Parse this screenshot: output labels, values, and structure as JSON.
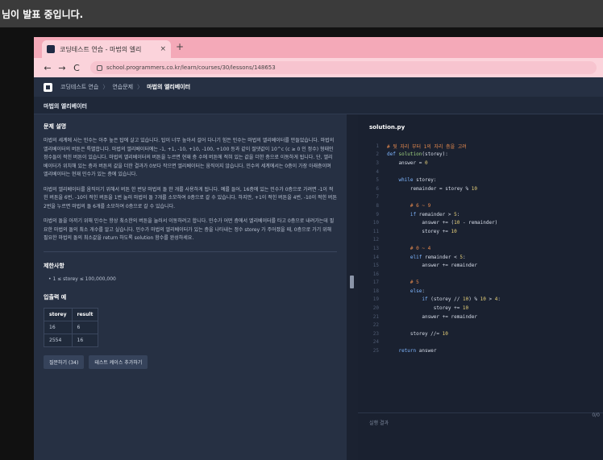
{
  "share_banner": {
    "text": "님이 발표 중입니다."
  },
  "browser": {
    "tab_title": "코딩테스트 연습 - 마법의 엘리",
    "tab_close": "×",
    "new_tab": "+",
    "nav_back": "←",
    "nav_forward": "→",
    "nav_reload": "C",
    "url": "school.programmers.co.kr/learn/courses/30/lessons/148653"
  },
  "app": {
    "breadcrumbs": [
      "코딩테스트 연습",
      "연습문제",
      "마법의 엘리베이터"
    ],
    "crumb_sep": "〉",
    "problem_title": "마법의 엘리베이터"
  },
  "problem": {
    "section_description": "문제 설명",
    "paragraphs": [
      "마법의 세계에 사는 민수는 아주 높은 탑에 살고 있습니다. 탑이 너무 높아서 걸어 다니기 힘든 민수는 마법의 엘리베이터를 만들었습니다. 마법의 엘리베이터의 버튼은 특별합니다. 마법의 엘리베이터에는 -1, +1, -10, +10, -100, +100 등과 같이 절댓값이 10^c (c ≥ 0 인 정수) 형태인 정수들이 적힌 버튼이 있습니다. 마법의 엘리베이터의 버튼을 누르면 현재 층 수에 버튼에 적혀 있는 값을 더한 층으로 이동하게 됩니다. 단, 엘리베이터가 위치해 있는 층과 버튼의 값을 더한 결과가 0보다 작으면 엘리베이터는 움직이지 않습니다. 민수의 세계에서는 0층이 가장 아래층이며 엘리베이터는 현재 민수가 있는 층에 있습니다.",
      "마법의 엘리베이터를 움직이기 위해서 버튼 한 번당 마법의 돌 한 개를 사용하게 됩니다. 예를 들어, 16층에 있는 민수가 0층으로 가려면 -1이 적힌 버튼을 6번, -10이 적힌 버튼을 1번 눌러 마법의 돌 7개를 소모하여 0층으로 갈 수 있습니다. 하지만, +1이 적힌 버튼을 4번, -10이 적힌 버튼 2번을 누르면 마법의 돌 6개를 소모하여 0층으로 갈 수 있습니다.",
      "마법의 돌을 아끼기 위해 민수는 항상 최소한의 버튼을 눌러서 이동하려고 합니다. 민수가 어떤 층에서 엘리베이터를 타고 0층으로 내려가는데 필요한 마법의 돌의 최소 개수를 알고 싶습니다. 민수가 마법의 엘리베이터가 있는 층을 나타내는 정수 storey 가 주어졌을 때, 0층으로 가기 위해 필요한 마법의 돌의 최소값을 return 하도록 solution 함수를 완성하세요."
    ],
    "section_constraints": "제한사항",
    "constraint": "• 1 ≤ storey ≤ 100,000,000",
    "section_examples": "입출력 예",
    "example_headers": [
      "storey",
      "result"
    ],
    "example_rows": [
      [
        "16",
        "6"
      ],
      [
        "2554",
        "16"
      ]
    ],
    "bottom_buttons": [
      "질문하기 (34)",
      "테스트 케이스 추가하기"
    ]
  },
  "editor": {
    "filename": "solution.py",
    "code_lines": [
      "# 뒷 자리 부터 1의 자리 층을 고려",
      "def solution(storey):",
      "    answer = 0",
      "",
      "    while storey:",
      "        remainder = storey % 10",
      "",
      "        # 6 ~ 9",
      "        if remainder > 5:",
      "            answer += (10 - remainder)",
      "            storey += 10",
      "",
      "        # 0 ~ 4",
      "        elif remainder < 5:",
      "            answer += remainder",
      "",
      "        # 5",
      "        else:",
      "            if (storey // 10) % 10 > 4:",
      "                storey += 10",
      "            answer += remainder",
      "",
      "        storey //= 10",
      "",
      "    return answer"
    ],
    "line_numbers": [
      "1",
      "2",
      "3",
      "4",
      "5",
      "6",
      "7",
      "8",
      "9",
      "10",
      "11",
      "12",
      "13",
      "14",
      "15",
      "16",
      "17",
      "18",
      "19",
      "20",
      "21",
      "22",
      "23",
      "24",
      "25"
    ],
    "footer_left": "실행 결과",
    "footer_right": "0/0"
  },
  "colors": {
    "keyword": "#7fb6ff",
    "comment": "#e78a4e",
    "number": "#e9d27a",
    "name": "#9fd27f"
  }
}
